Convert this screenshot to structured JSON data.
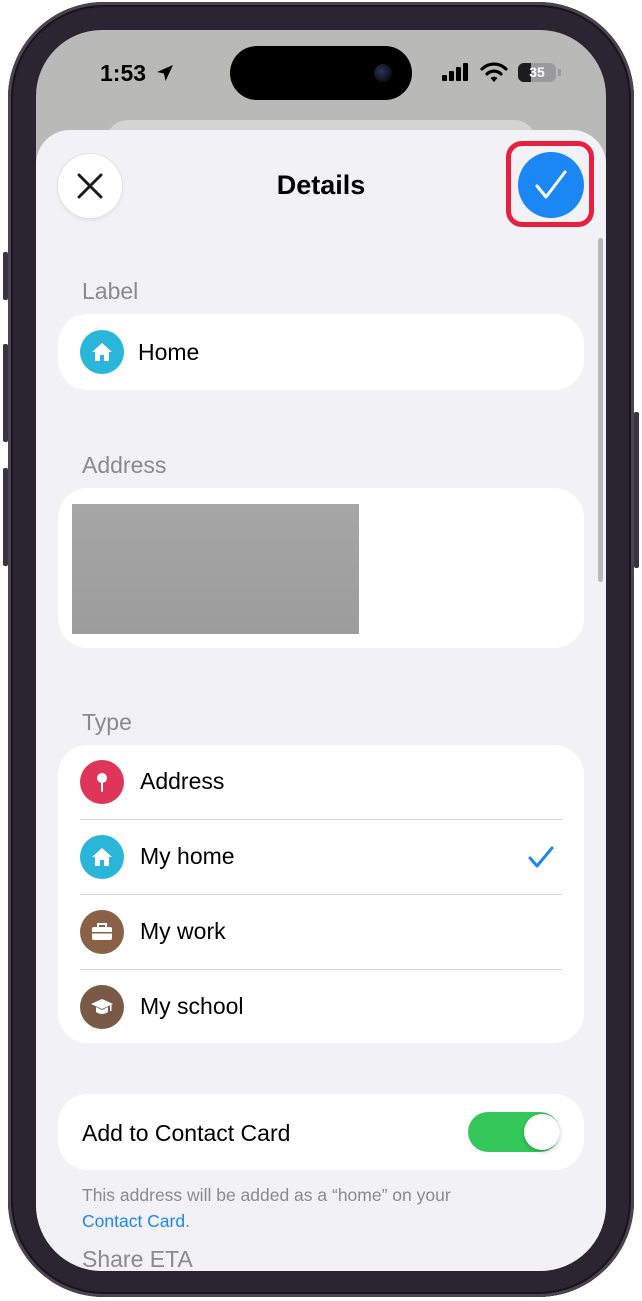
{
  "status_bar": {
    "time": "1:53",
    "battery": "35",
    "battery_level": 0.35,
    "icons": [
      "location-arrow-icon",
      "cellular-signal-icon",
      "wifi-icon",
      "battery-icon"
    ]
  },
  "header": {
    "title": "Details",
    "close_icon": "close-icon",
    "done_icon": "checkmark-icon",
    "highlight_color": "#e8203f"
  },
  "label_section": {
    "heading": "Label",
    "value": "Home",
    "icon": "house-icon",
    "icon_color": "#29b6d8"
  },
  "address_section": {
    "heading": "Address",
    "content": "redacted"
  },
  "type_section": {
    "heading": "Type",
    "options": [
      {
        "label": "Address",
        "icon": "pin-icon",
        "color": "#e0355b",
        "selected": false
      },
      {
        "label": "My home",
        "icon": "house-icon",
        "color": "#29b6d8",
        "selected": true
      },
      {
        "label": "My work",
        "icon": "briefcase-icon",
        "color": "#8a6146",
        "selected": false
      },
      {
        "label": "My school",
        "icon": "graduation-cap-icon",
        "color": "#7a5a46",
        "selected": false
      }
    ]
  },
  "contact_card": {
    "label": "Add to Contact Card",
    "toggle_on": true,
    "toggle_color": "#34c759",
    "footnote_text": "This address will be added as a “home” on your",
    "footnote_link": "Contact Card",
    "footnote_end": "."
  },
  "share_eta": {
    "heading": "Share ETA"
  },
  "accent_color": "#1b87f4"
}
